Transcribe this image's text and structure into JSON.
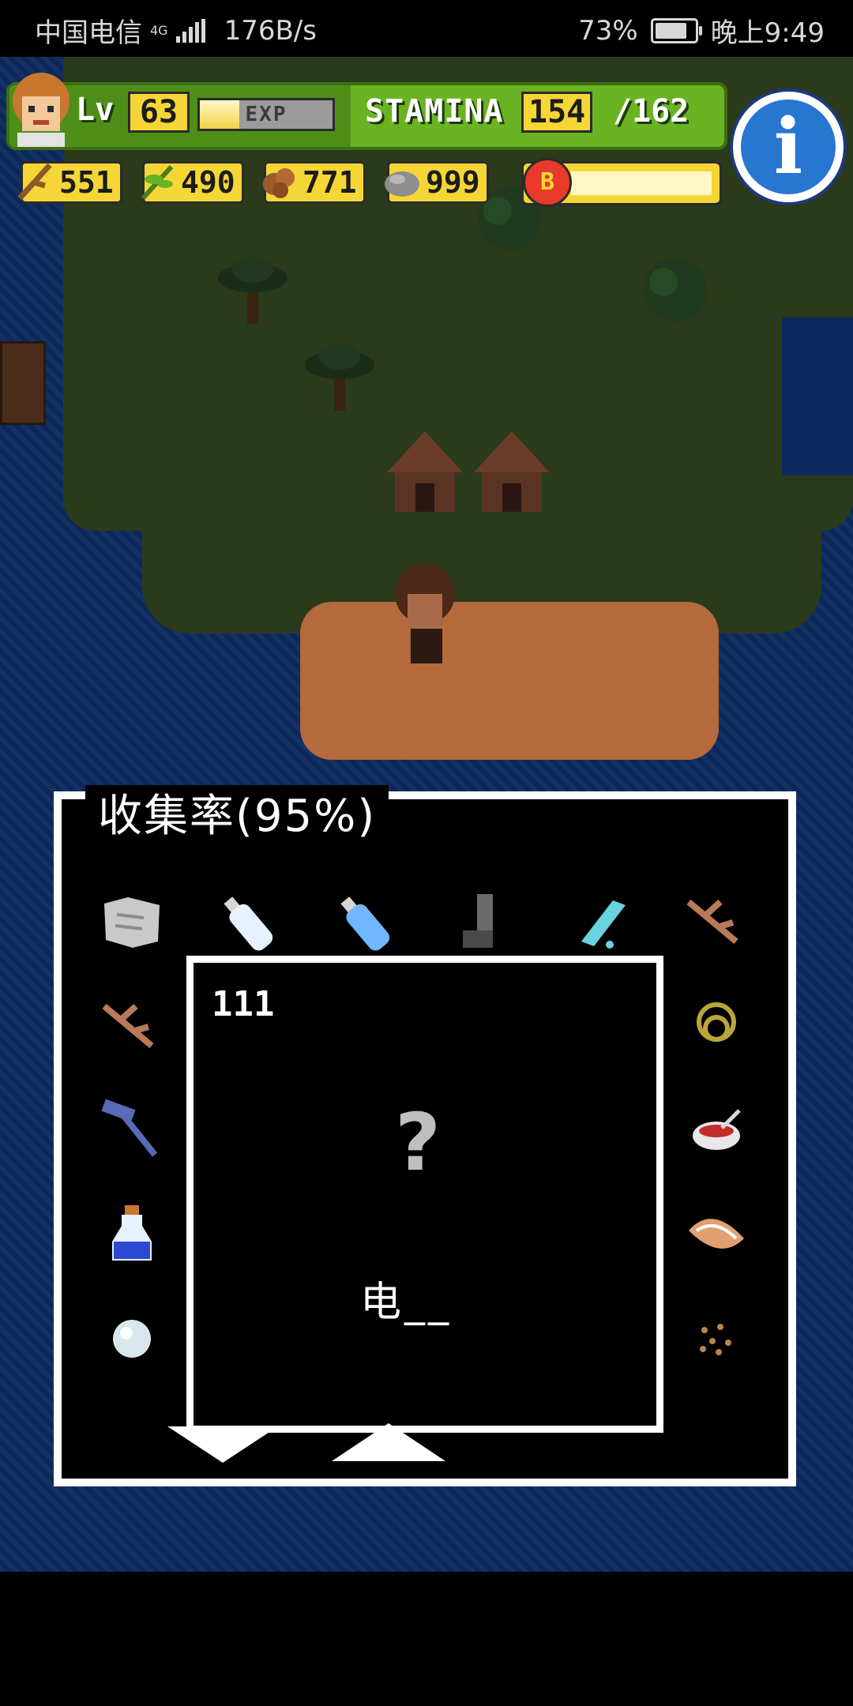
{
  "status_bar": {
    "carrier": "中国电信",
    "network": "4G",
    "speed": "176B/s",
    "battery": "73%",
    "battery_level": 0.73,
    "time": "晚上9:49"
  },
  "hud": {
    "level_label": "Lv",
    "level": "63",
    "exp_label": "EXP",
    "exp_fill": 0.3,
    "stamina_label": "STAMINA",
    "stamina": "154",
    "stamina_max": "/162"
  },
  "resources": [
    {
      "icon": "branch-icon",
      "value": "551"
    },
    {
      "icon": "leaf-icon",
      "value": "490"
    },
    {
      "icon": "nut-icon",
      "value": "771"
    },
    {
      "icon": "stone-icon",
      "value": "999"
    }
  ],
  "bonus": {
    "icon_label": "B"
  },
  "panel": {
    "title": "收集率(95%)",
    "detail_number": "111",
    "detail_symbol": "?",
    "detail_name": "电__"
  },
  "colors": {
    "ocean": "#0d2a5e",
    "hud_green": "#6ab323",
    "hud_yellow": "#f6d636",
    "info_blue": "#2777d1"
  }
}
